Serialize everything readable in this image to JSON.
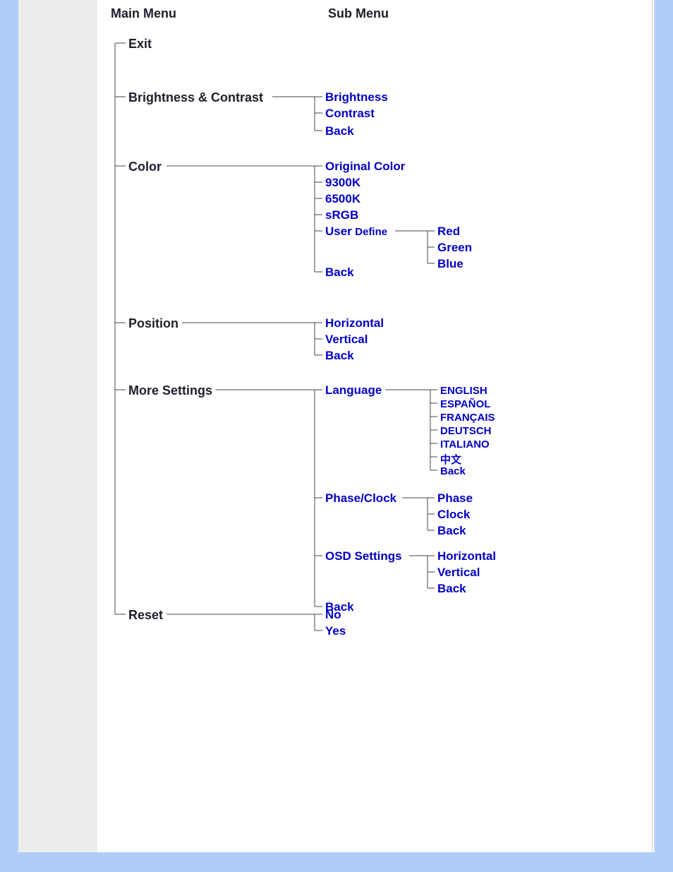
{
  "headers": {
    "main": "Main Menu",
    "sub": "Sub Menu"
  },
  "main": {
    "exit": "Exit",
    "brightness_contrast": "Brightness & Contrast",
    "color": "Color",
    "position": "Position",
    "more_settings": "More Settings",
    "reset": "Reset"
  },
  "brightness_contrast": {
    "brightness": "Brightness",
    "contrast": "Contrast",
    "back": "Back"
  },
  "color": {
    "original": "Original Color",
    "k9300": "9300K",
    "k6500": "6500K",
    "srgb": "sRGB",
    "user_define": "User",
    "user_define_small": "Define",
    "back": "Back",
    "user": {
      "red": "Red",
      "green": "Green",
      "blue": "Blue"
    }
  },
  "position": {
    "horizontal": "Horizontal",
    "vertical": "Vertical",
    "back": "Back"
  },
  "more": {
    "language": "Language",
    "phase_clock": "Phase/Clock",
    "osd_settings": "OSD Settings",
    "back": "Back",
    "lang": {
      "english": "ENGLISH",
      "espanol": "ESPAÑOL",
      "francais": "FRANÇAIS",
      "deutsch": "DEUTSCH",
      "italiano": "ITALIANO",
      "chinese": "中文",
      "back": "Back"
    },
    "phase": {
      "phase": "Phase",
      "clock": "Clock",
      "back": "Back"
    },
    "osd": {
      "horizontal": "Horizontal",
      "vertical": "Vertical",
      "back": "Back"
    }
  },
  "reset": {
    "no": "No",
    "yes": "Yes"
  }
}
